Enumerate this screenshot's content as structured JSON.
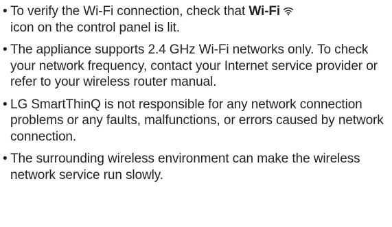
{
  "notes": [
    {
      "bullet": "•",
      "before": "To verify the Wi-Fi connection, check that ",
      "bold": "Wi-Fi",
      "icon": "wifi-icon",
      "after": "icon on the control panel is lit."
    },
    {
      "bullet": "•",
      "text": "The appliance supports 2.4 GHz Wi-Fi networks only. To check your network frequency, contact your Internet service provider or refer to your wireless router manual."
    },
    {
      "bullet": "•",
      "text": "LG SmartThinQ is not responsible for any network connection problems or any faults, malfunctions, or errors caused by network connection."
    },
    {
      "bullet": "•",
      "text": "The surrounding wireless environment can make the wireless network service run slowly."
    }
  ],
  "colors": {
    "text": "#231f20",
    "background": "#ffffff"
  }
}
